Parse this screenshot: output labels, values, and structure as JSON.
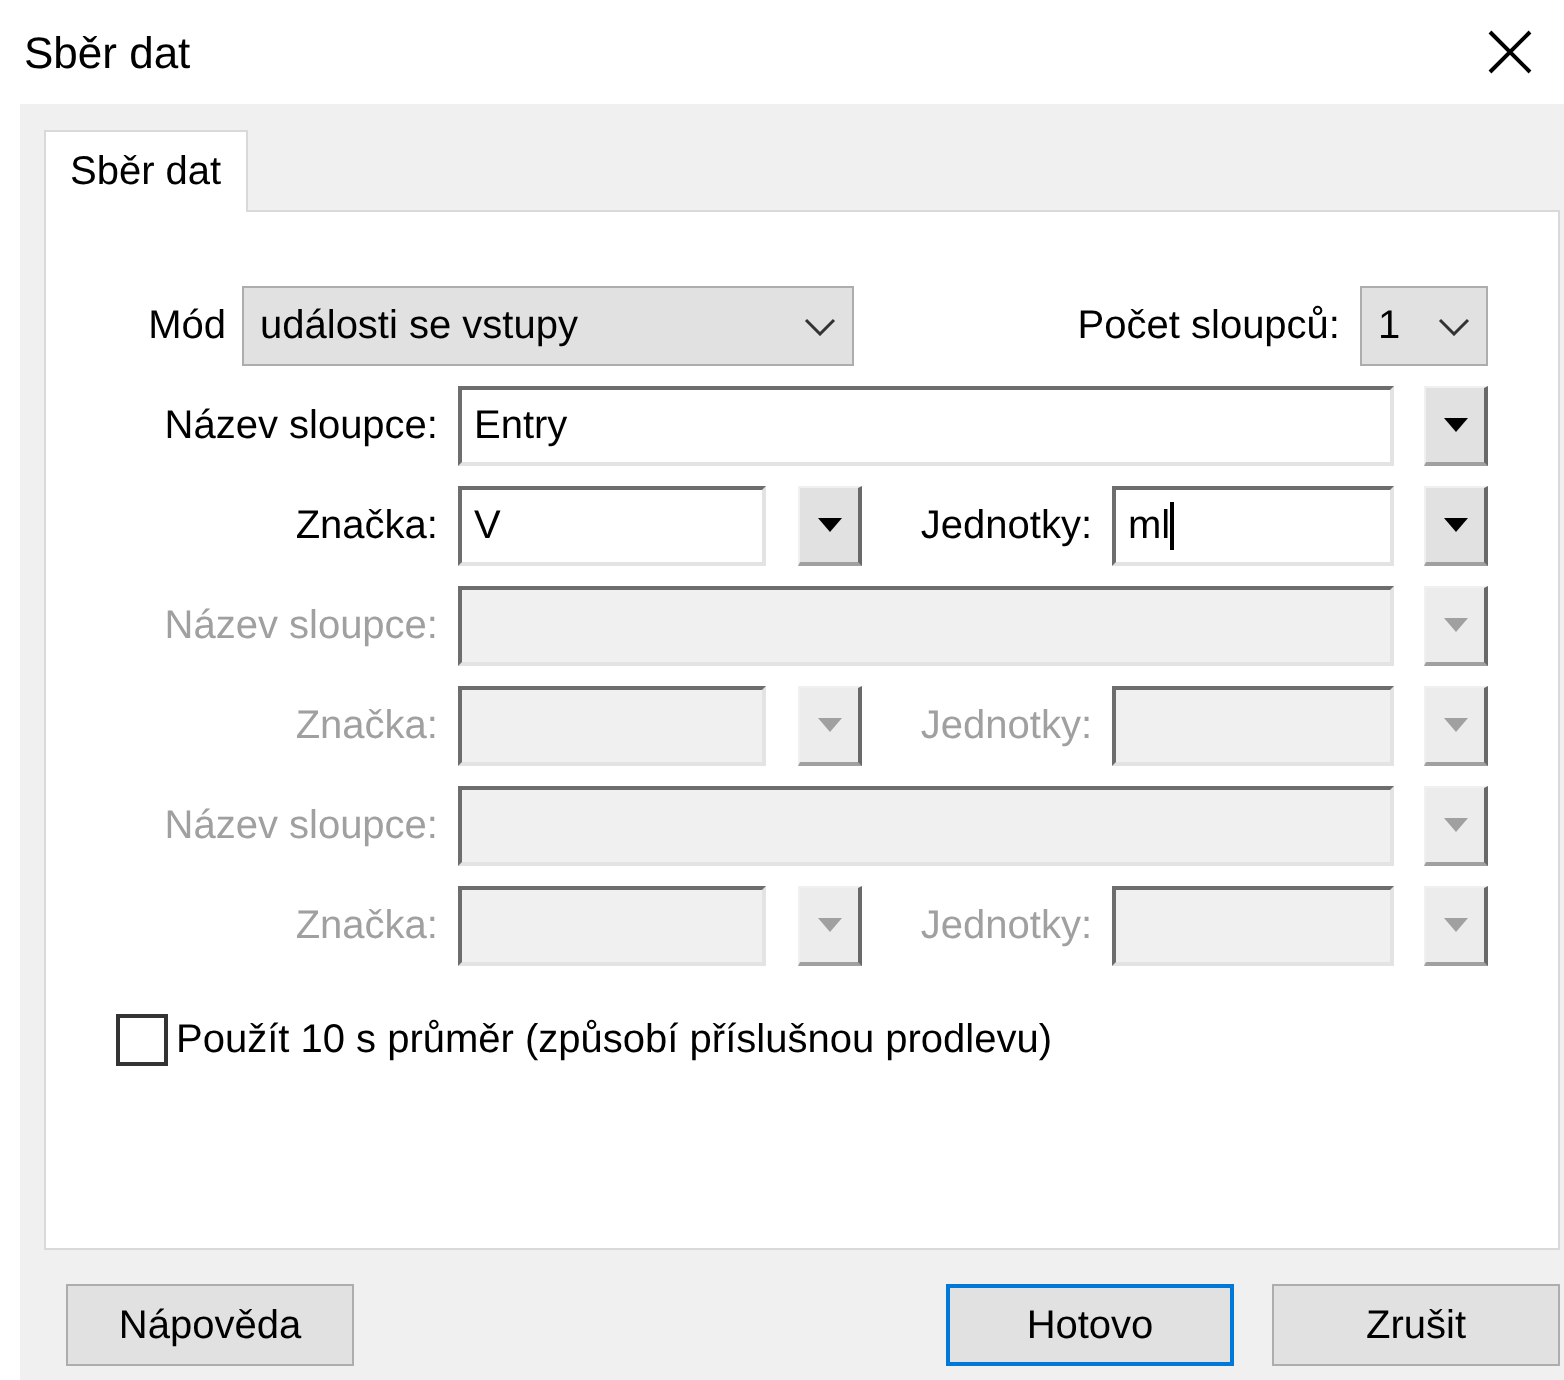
{
  "window": {
    "title": "Sběr dat"
  },
  "tabs": [
    {
      "label": "Sběr dat",
      "selected": true
    }
  ],
  "mode": {
    "label": "Mód",
    "value": "události se vstupy"
  },
  "column_count": {
    "label": "Počet sloupců:",
    "value": "1"
  },
  "columns": [
    {
      "disabled": false,
      "name_label": "Název sloupce:",
      "name_value": "Entry",
      "symbol_label": "Značka:",
      "symbol_value": "V",
      "units_label": "Jednotky:",
      "units_value": "ml",
      "units_focused": true
    },
    {
      "disabled": true,
      "name_label": "Název sloupce:",
      "symbol_label": "Značka:",
      "units_label": "Jednotky:",
      "units_focused": false
    },
    {
      "disabled": true,
      "name_label": "Název sloupce:",
      "symbol_label": "Značka:",
      "units_label": "Jednotky:",
      "units_focused": false
    }
  ],
  "average": {
    "label": "Použít 10 s průměr (způsobí příslušnou prodlevu)",
    "checked": false
  },
  "buttons": [
    {
      "label": "Nápověda",
      "default": false
    },
    {
      "label": "Hotovo",
      "default": true
    },
    {
      "label": "Zrušit",
      "default": false
    }
  ]
}
